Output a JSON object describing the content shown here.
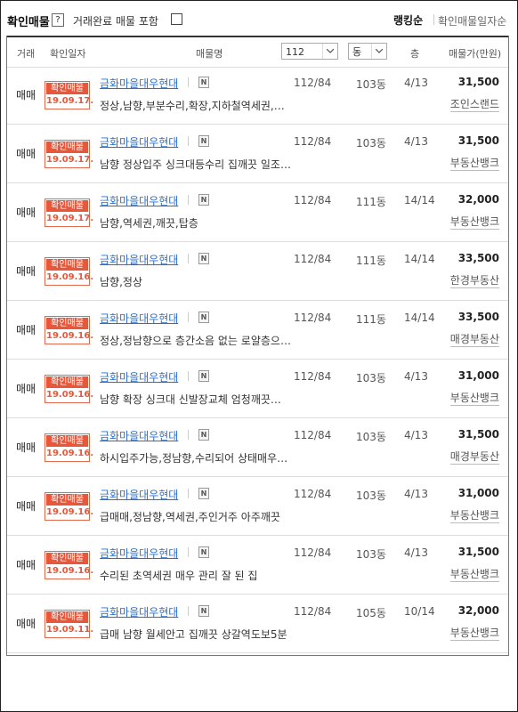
{
  "topbar": {
    "title": "확인매물",
    "help": "?",
    "include_label": "거래완료 매물 포함",
    "rank_label": "랭킹순",
    "date_label": "확인매물일자순"
  },
  "header": {
    "type": "거래",
    "date": "확인일자",
    "name": "매물명",
    "area_select": "112",
    "dong_select": "동",
    "floor": "층",
    "price": "매물가(만원)"
  },
  "rows": [
    {
      "type": "매매",
      "badge": "확인매물",
      "date": "19.09.17.",
      "name": "금화마을대우현대",
      "n": "N",
      "area": "112/84",
      "dong": "103동",
      "floor": "4/13",
      "price": "31,500",
      "desc": "정상,남향,부분수리,확장,지하철역세권,…",
      "agent": "조인스랜드"
    },
    {
      "type": "매매",
      "badge": "확인매물",
      "date": "19.09.17.",
      "name": "금화마을대우현대",
      "n": "N",
      "area": "112/84",
      "dong": "103동",
      "floor": "4/13",
      "price": "31,500",
      "desc": "남향 정상입주 싱크대등수리 집깨끗 일조…",
      "agent": "부동산뱅크"
    },
    {
      "type": "매매",
      "badge": "확인매물",
      "date": "19.09.17.",
      "name": "금화마을대우현대",
      "n": "N",
      "area": "112/84",
      "dong": "111동",
      "floor": "14/14",
      "price": "32,000",
      "desc": "남향,역세권,깨끗,탑층",
      "agent": "부동산뱅크"
    },
    {
      "type": "매매",
      "badge": "확인매물",
      "date": "19.09.16.",
      "name": "금화마을대우현대",
      "n": "N",
      "area": "112/84",
      "dong": "111동",
      "floor": "14/14",
      "price": "33,500",
      "desc": "남향,정상",
      "agent": "한경부동산"
    },
    {
      "type": "매매",
      "badge": "확인매물",
      "date": "19.09.16.",
      "name": "금화마을대우현대",
      "n": "N",
      "area": "112/84",
      "dong": "111동",
      "floor": "14/14",
      "price": "33,500",
      "desc": "정상,정남향으로 층간소음 없는 로얄층으…",
      "agent": "매경부동산"
    },
    {
      "type": "매매",
      "badge": "확인매물",
      "date": "19.09.16.",
      "name": "금화마을대우현대",
      "n": "N",
      "area": "112/84",
      "dong": "103동",
      "floor": "4/13",
      "price": "31,000",
      "desc": "남향 확장 싱크대 신발장교체 엄청깨끗…",
      "agent": "부동산뱅크"
    },
    {
      "type": "매매",
      "badge": "확인매물",
      "date": "19.09.16.",
      "name": "금화마을대우현대",
      "n": "N",
      "area": "112/84",
      "dong": "103동",
      "floor": "4/13",
      "price": "31,500",
      "desc": "하시입주가능,정남향,수리되어 상태매우…",
      "agent": "매경부동산"
    },
    {
      "type": "매매",
      "badge": "확인매물",
      "date": "19.09.16.",
      "name": "금화마을대우현대",
      "n": "N",
      "area": "112/84",
      "dong": "103동",
      "floor": "4/13",
      "price": "31,000",
      "desc": "급매매,정남향,역세권,주인거주 아주깨끗",
      "agent": "부동산뱅크"
    },
    {
      "type": "매매",
      "badge": "확인매물",
      "date": "19.09.16.",
      "name": "금화마을대우현대",
      "n": "N",
      "area": "112/84",
      "dong": "103동",
      "floor": "4/13",
      "price": "31,500",
      "desc": "수리된 초역세권 매우 관리 잘 된 집",
      "agent": "부동산뱅크"
    },
    {
      "type": "매매",
      "badge": "확인매물",
      "date": "19.09.11.",
      "name": "금화마을대우현대",
      "n": "N",
      "area": "112/84",
      "dong": "105동",
      "floor": "10/14",
      "price": "32,000",
      "desc": "급매 남향 월세안고 집깨끗 상갈역도보5분",
      "agent": "부동산뱅크"
    }
  ]
}
